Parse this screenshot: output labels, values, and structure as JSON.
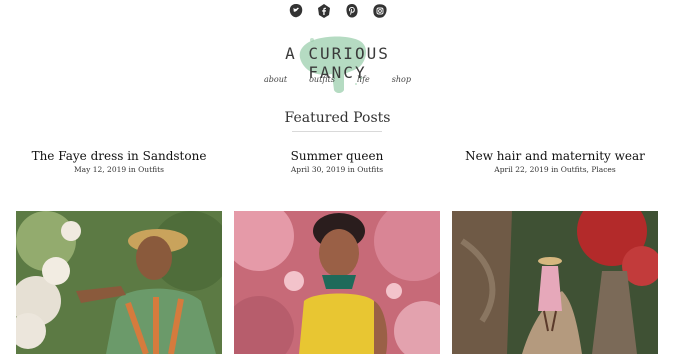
{
  "social_icons": [
    "twitter-icon",
    "facebook-icon",
    "pinterest-icon",
    "instagram-icon"
  ],
  "logo": {
    "title": "A CURIOUS FANCY",
    "accent": "#9ccfae"
  },
  "nav": [
    {
      "label": "about"
    },
    {
      "label": "outfits"
    },
    {
      "label": "life"
    },
    {
      "label": "shop"
    }
  ],
  "featured": {
    "heading": "Featured Posts",
    "posts": [
      {
        "title": "The Faye dress in Sandstone",
        "date": "May 12, 2019",
        "in": "in",
        "categories": "Outfits"
      },
      {
        "title": "Summer queen",
        "date": "April 30, 2019",
        "in": "in",
        "categories": "Outfits"
      },
      {
        "title": "New hair and maternity wear",
        "date": "April 22, 2019",
        "in": "in",
        "categories": "Outfits, Places"
      }
    ]
  }
}
